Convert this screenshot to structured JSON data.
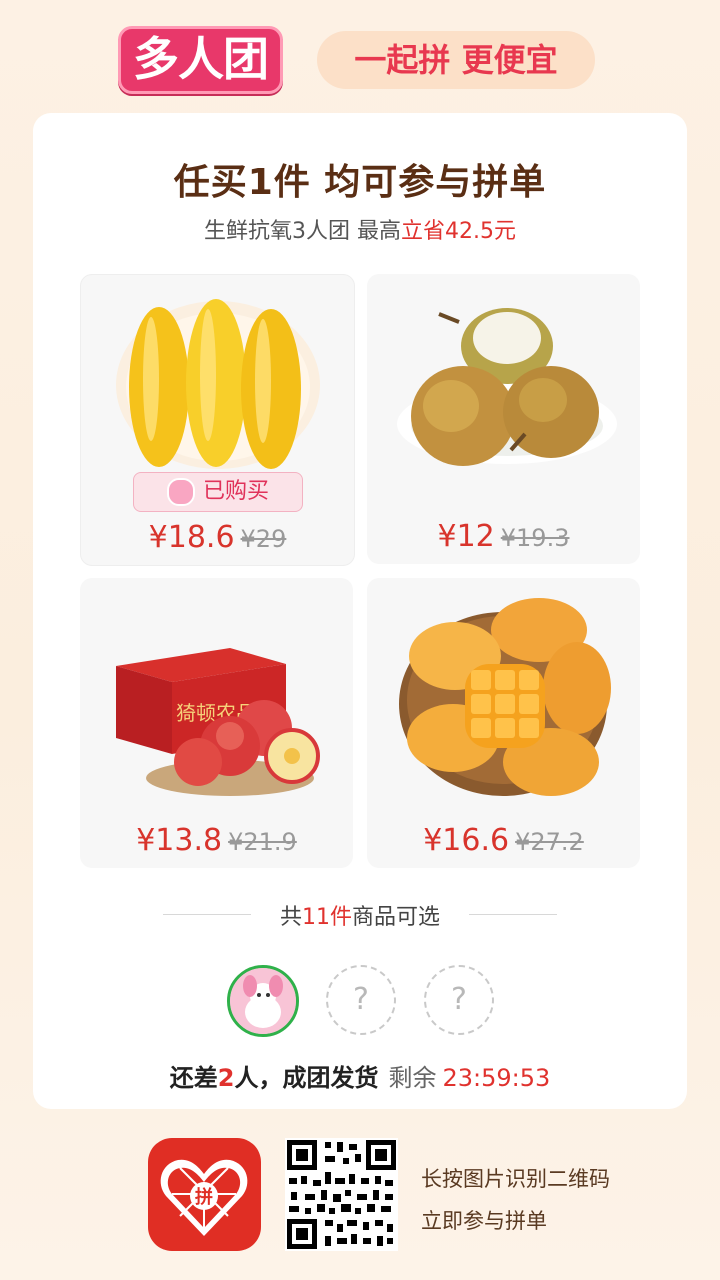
{
  "header": {
    "logo_text": "多人团",
    "slogan": "一起拼 更便宜"
  },
  "card": {
    "headline": "任买1件 均可参与拼单",
    "subline_prefix": "生鲜抗氧3人团 最高",
    "subline_highlight": "立省42.5元"
  },
  "products": [
    {
      "name": "corn",
      "price": "¥18.6",
      "original_price": "¥29",
      "badge": "已购买"
    },
    {
      "name": "pear",
      "price": "¥12",
      "original_price": "¥19.3"
    },
    {
      "name": "apple-box",
      "price": "¥13.8",
      "original_price": "¥21.9",
      "box_text": "猗顿农品"
    },
    {
      "name": "mango",
      "price": "¥16.6",
      "original_price": "¥27.2"
    }
  ],
  "count": {
    "prefix": "共",
    "number": "11件",
    "suffix": "商品可选"
  },
  "group": {
    "placeholder_symbol": "?",
    "status_prefix": "还差",
    "status_number": "2",
    "status_suffix": "人，成团发货",
    "remaining_label": "剩余",
    "timer": "23:59:53"
  },
  "footer": {
    "app_icon_text": "拼",
    "hint_line1": "长按图片识别二维码",
    "hint_line2": "立即参与拼单"
  },
  "colors": {
    "accent_red": "#e0322e",
    "brand_pink": "#e8386a",
    "headline_brown": "#5a2e14"
  }
}
